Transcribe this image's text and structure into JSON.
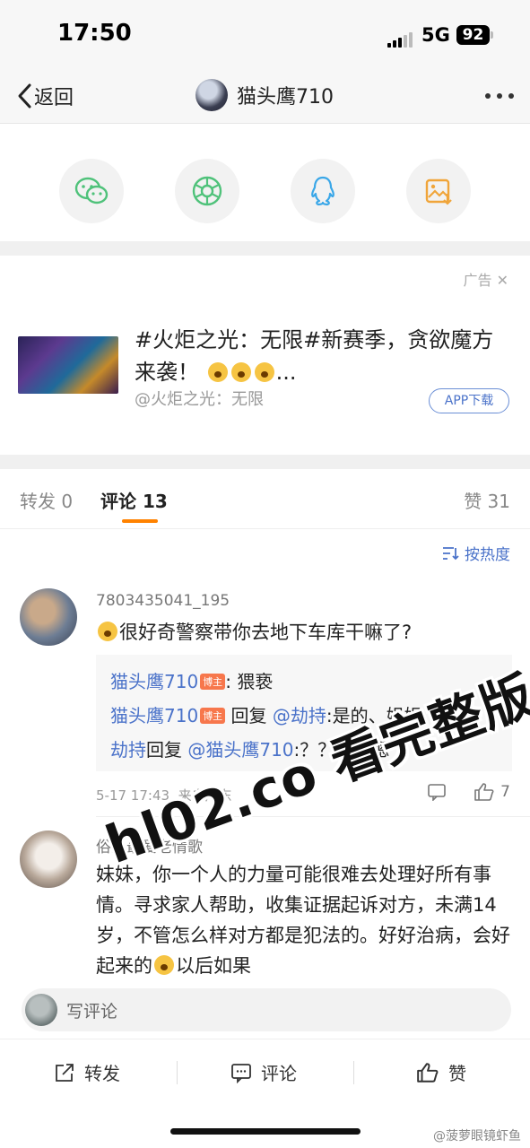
{
  "status_bar": {
    "time": "17:50",
    "network": "5G",
    "battery": "92"
  },
  "nav": {
    "back_label": "返回",
    "title": "猫头鹰710"
  },
  "share_icons": [
    "wechat-icon",
    "moments-icon",
    "qq-icon",
    "save-image-icon"
  ],
  "ad": {
    "tag": "广告",
    "text": "#火炬之光：无限#新赛季，贪欲魔方来袭！",
    "source": "@火炬之光：无限",
    "button": "APP下载"
  },
  "tabs": {
    "repost": "转发 0",
    "comments": "评论 13",
    "likes": "赞 31"
  },
  "sort_label": "按热度",
  "comment1": {
    "user": "7803435041_195",
    "text": "很好奇警察带你去地下车库干嘛了?",
    "replies": [
      {
        "name": "猫头鹰710",
        "badge": "博主",
        "text": ": 猥亵"
      },
      {
        "name": "猫头鹰710",
        "badge": "博主",
        "text": " 回复 ",
        "mention": "@劫持",
        "after": ":是的、姐姐"
      },
      {
        "name": "劫持",
        "text": "回复 ",
        "mention": "@猫头鹰710",
        "after": ":？？？？嗯"
      }
    ],
    "time": "5-17 17:43",
    "location": "来自广东",
    "likes": "7"
  },
  "comment2": {
    "user": "俗人最爱老情歌",
    "text": "妹妹，你一个人的力量可能很难去处理好所有事情。寻求家人帮助，收集证据起诉对方，未满14岁，不管怎么样对方都是犯法的。好好治病，会好起来的",
    "text_tail": "以后如果"
  },
  "watermark": "hl02.co 看完整版",
  "bottom": {
    "write_placeholder": "写评论",
    "repost": "转发",
    "comment": "评论",
    "like": "赞"
  },
  "credit": "@菠萝眼镜虾鱼",
  "colors": {
    "accent": "#ff8200",
    "link": "#4a72c9",
    "badge": "#f7774c"
  }
}
